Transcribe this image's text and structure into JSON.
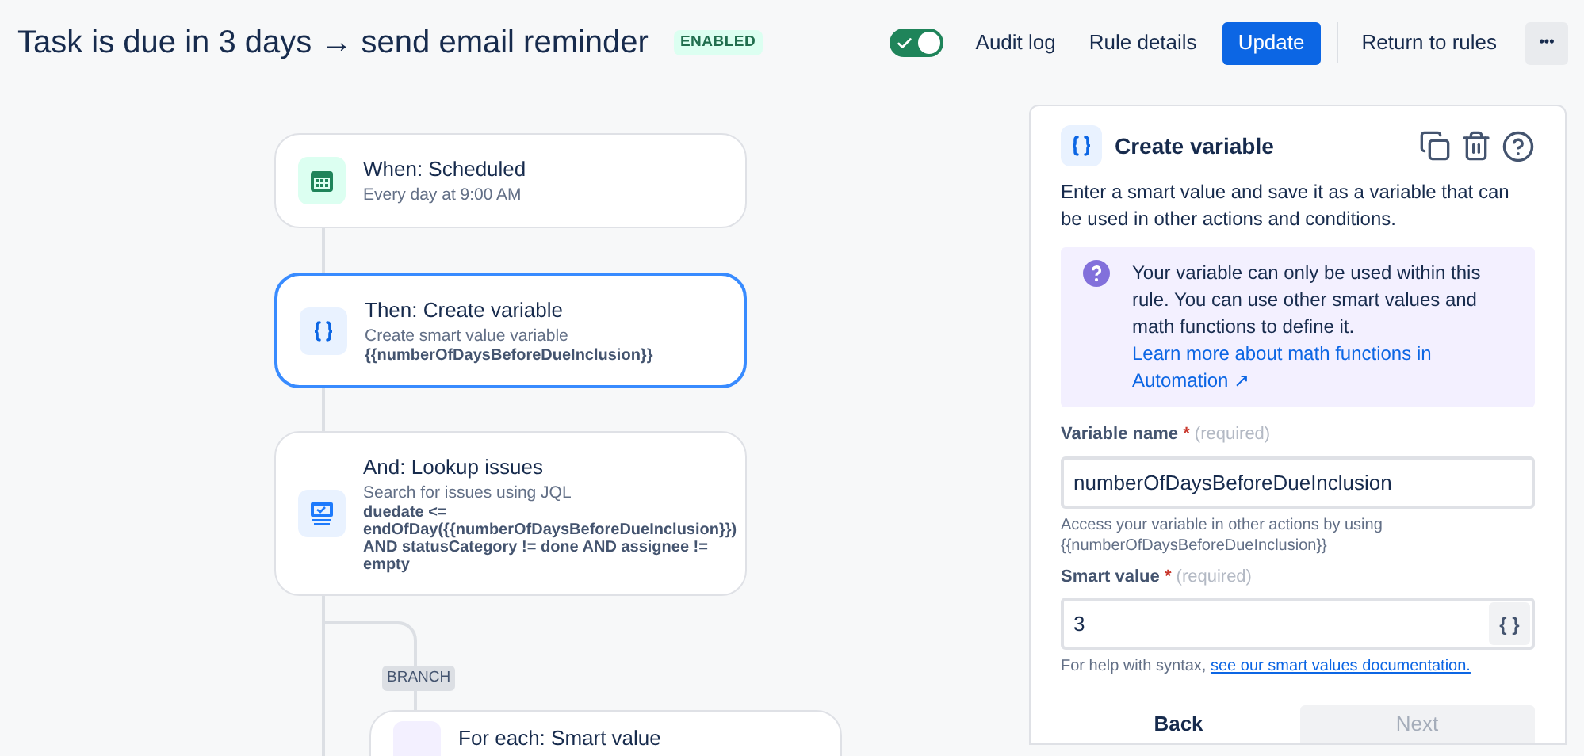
{
  "header": {
    "title": "Task is due in 3 days → send email reminder",
    "badge": "ENABLED",
    "toggle": {
      "on": true
    },
    "actions": [
      {
        "kind": "link",
        "label": "Audit log"
      },
      {
        "kind": "link",
        "label": "Rule details"
      },
      {
        "kind": "primary",
        "label": "Update"
      },
      {
        "kind": "divider"
      },
      {
        "kind": "link",
        "label": "Return to rules"
      },
      {
        "kind": "more",
        "label": "•••"
      }
    ]
  },
  "nodes": [
    {
      "kind": "calendar",
      "title": "When: Scheduled",
      "subtitle": "Every day at 9:00 AM",
      "selected": false
    },
    {
      "kind": "variable",
      "title": "Then: Create variable",
      "subtitle": "Create smart value variable",
      "detail": "{{numberOfDaysBeforeDueInclusion}}",
      "selected": true
    },
    {
      "kind": "lookup",
      "title": "And: Lookup issues",
      "subtitle": "Search for issues using JQL",
      "detail": "duedate <= endOfDay({{numberOfDaysBeforeDueInclusion}}) AND statusCategory != done AND assignee != empty",
      "selected": false
    }
  ],
  "branch": {
    "label": "BRANCH",
    "node": {
      "kind": "foreach",
      "title": "For each: Smart value",
      "selected": false
    }
  },
  "panel": {
    "title": "Create variable",
    "description": "Enter a smart value and save it as a variable that can be used in other actions and conditions.",
    "info": {
      "text": "Your variable can only be used within this rule. You can use other smart values and math functions to define it. ",
      "link": "Learn more about math functions in Automation ↗"
    },
    "fields": [
      {
        "kind": "text",
        "label": "Variable name",
        "marker": "*",
        "hint": "(required)",
        "value": "numberOfDaysBeforeDueInclusion",
        "help": "Access your variable in other actions by using {{numberOfDaysBeforeDueInclusion}}"
      },
      {
        "kind": "smart",
        "label": "Smart value",
        "marker": "*",
        "hint": "(required)",
        "value": "3",
        "button": "{ }",
        "help": "For help with syntax, ",
        "help_link": "see our smart values documentation."
      }
    ],
    "buttons": [
      {
        "label": "Back",
        "disabled": false
      },
      {
        "label": "Next",
        "disabled": true
      }
    ]
  }
}
